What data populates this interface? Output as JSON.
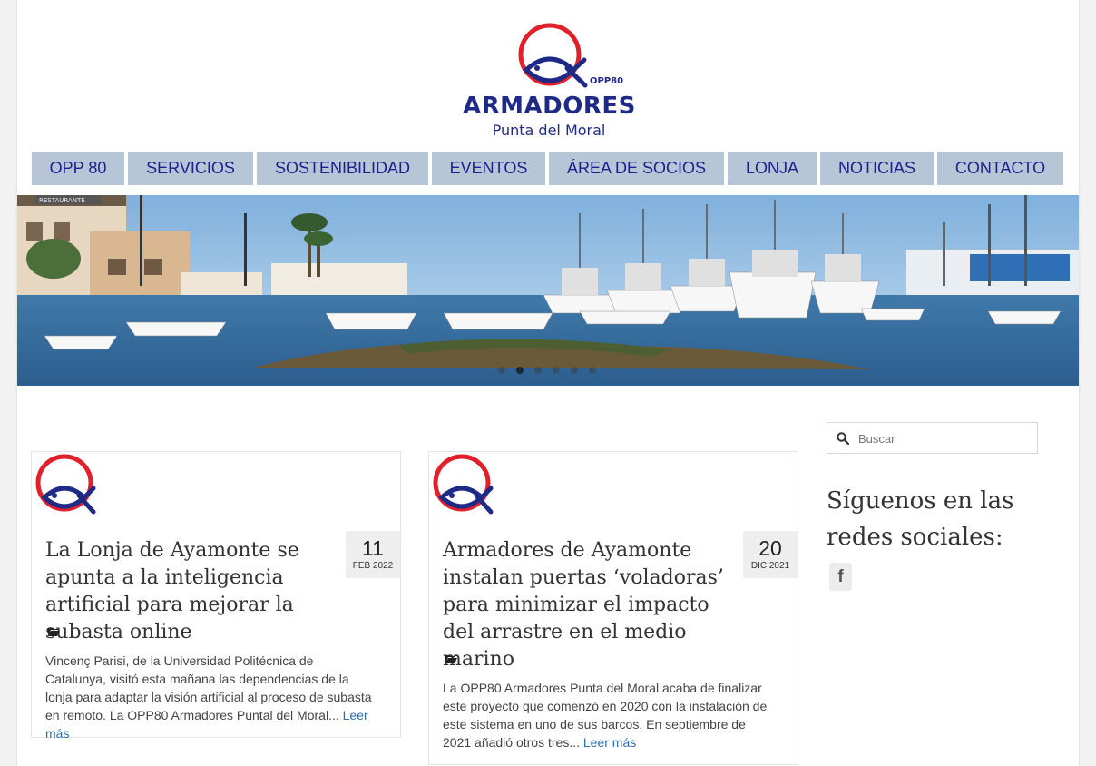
{
  "logo": {
    "brand": "ARMADORES",
    "place": "Punta del Moral",
    "tag": "OPP80"
  },
  "nav": [
    "OPP 80",
    "SERVICIOS",
    "SOSTENIBILIDAD",
    "EVENTOS",
    "ÁREA DE SOCIOS",
    "LONJA",
    "NOTICIAS",
    "CONTACTO"
  ],
  "hero": {
    "sign": "RESTAURANTE",
    "slide_count": 6,
    "active_slide": 2
  },
  "posts": [
    {
      "day": "11",
      "month": "FEB 2022",
      "title": "La Lonja de Ayamonte se apunta a la inteligencia artificial para mejorar la subasta online",
      "excerpt": "Vincenç Parisi, de la Universidad Politécnica de Catalunya, visitó esta mañana las dependencias de la lonja para adaptar la visión artificial al proceso de subasta en remoto. La OPP80 Armadores Puntal del Moral...",
      "more": "Leer más"
    },
    {
      "day": "20",
      "month": "DIC 2021",
      "title": "Armadores de Ayamonte instalan puertas ‘voladoras’ para minimizar el impacto del arrastre en el medio marino",
      "excerpt": "La OPP80 Armadores Punta del Moral acaba de finalizar este proyecto que comenzó en 2020 con la instalación de este sistema en uno de sus barcos. En septiembre de 2021 añadió otros tres...",
      "more": "Leer más"
    }
  ],
  "sidebar": {
    "search_placeholder": "Buscar",
    "follow_title": "Síguenos en las redes sociales:",
    "facebook": "f"
  },
  "colors": {
    "nav_bg": "#b6c6d7",
    "nav_text": "#1d1f8f",
    "brand_red": "#e0202a",
    "brand_blue": "#1e2a86",
    "link": "#2a6fb0"
  }
}
